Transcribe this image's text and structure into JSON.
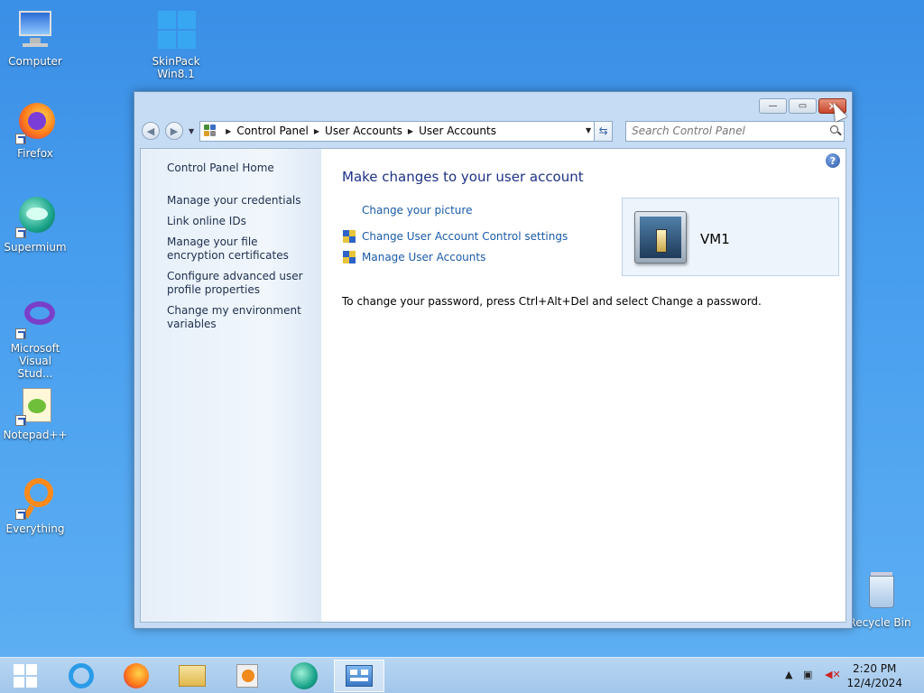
{
  "desktop": {
    "icons": [
      {
        "label": "Computer",
        "icon": "computer-icon"
      },
      {
        "label": "SkinPack\nWin8.1",
        "icon": "skinpack-icon"
      },
      {
        "label": "Firefox",
        "icon": "firefox-icon"
      },
      {
        "label": "Supermium",
        "icon": "supermium-icon"
      },
      {
        "label": "Microsoft\nVisual Stud...",
        "icon": "visual-studio-icon"
      },
      {
        "label": "Notepad++",
        "icon": "notepadpp-icon"
      },
      {
        "label": "Everything",
        "icon": "everything-icon"
      },
      {
        "label": "Recycle Bin",
        "icon": "recycle-bin-icon"
      }
    ]
  },
  "window": {
    "caption": {
      "minimize": "—",
      "maximize": "▭",
      "close": "✕"
    },
    "breadcrumb": [
      "Control Panel",
      "User Accounts",
      "User Accounts"
    ],
    "search_placeholder": "Search Control Panel",
    "left_links": [
      "Control Panel Home",
      "Manage your credentials",
      "Link online IDs",
      "Manage your file encryption certificates",
      "Configure advanced user profile properties",
      "Change my environment variables"
    ],
    "heading": "Make changes to your user account",
    "tasks": [
      "Change your picture",
      "Change User Account Control settings",
      "Manage User Accounts"
    ],
    "note": "To change your password, press Ctrl+Alt+Del and select Change a password.",
    "user": {
      "name": "VM1"
    },
    "help": "?"
  },
  "taskbar": {
    "apps": [
      "start-button",
      "internet-explorer-icon",
      "firefox-icon",
      "file-explorer-icon",
      "media-player-icon",
      "supermium-icon",
      "control-panel-icon"
    ],
    "time": "2:20 PM",
    "date": "12/4/2024"
  },
  "colors": {
    "accent": "#1e3287",
    "link": "#1a5aa8"
  }
}
